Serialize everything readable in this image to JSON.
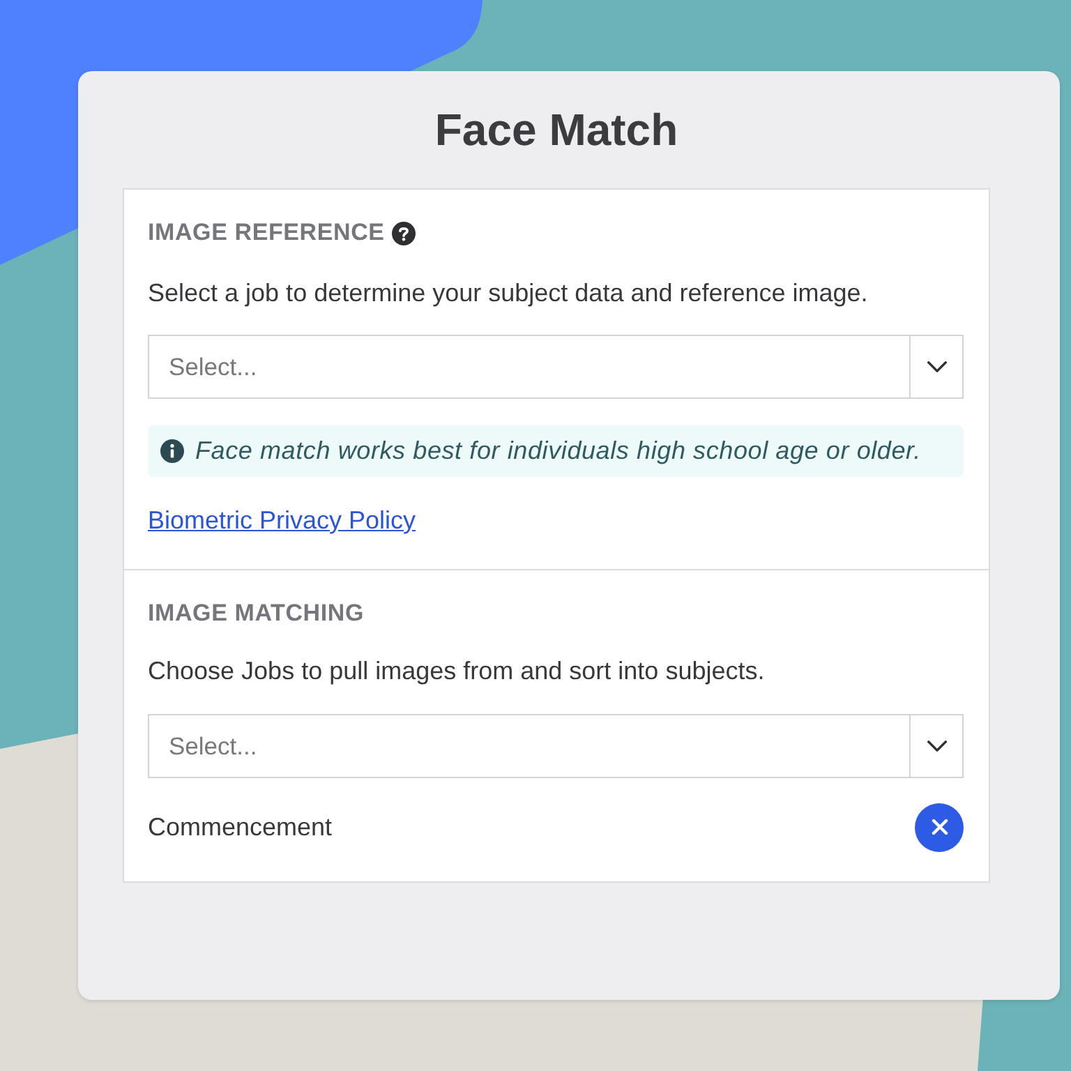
{
  "title": "Face Match",
  "sections": [
    {
      "heading": "IMAGE REFERENCE",
      "help_icon": true,
      "description": "Select a job to determine your subject data and reference image.",
      "select": {
        "placeholder": "Select..."
      },
      "info": "Face match works best for individuals high school age or older.",
      "link": "Biometric Privacy Policy"
    },
    {
      "heading": "IMAGE MATCHING",
      "help_icon": false,
      "description": "Choose Jobs to pull images from and sort into subjects.",
      "select": {
        "placeholder": "Select..."
      },
      "chosen_items": [
        {
          "label": "Commencement"
        }
      ]
    }
  ]
}
